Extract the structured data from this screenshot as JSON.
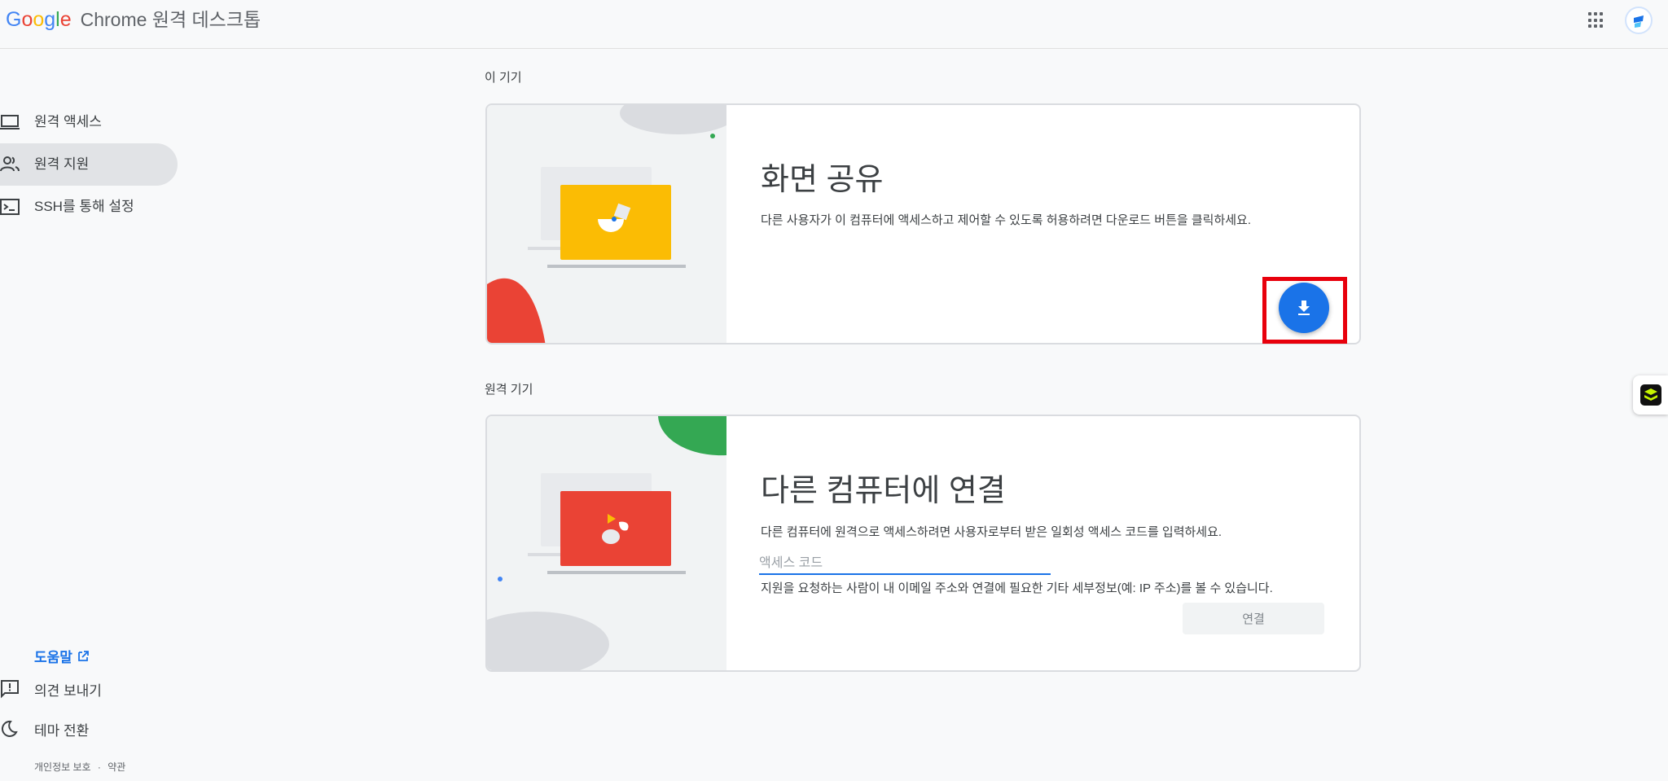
{
  "header": {
    "logo_letters": [
      "G",
      "o",
      "o",
      "g",
      "l",
      "e"
    ],
    "logo_colors": [
      "#4285f4",
      "#ea4335",
      "#fbbc05",
      "#4285f4",
      "#34a853",
      "#ea4335"
    ],
    "product_name": "Chrome 원격 데스크톱",
    "apps_icon": "apps-grid-icon",
    "avatar_icon": "account-avatar"
  },
  "sidebar": {
    "items": [
      {
        "label": "원격 액세스",
        "icon": "laptop-icon",
        "active": false
      },
      {
        "label": "원격 지원",
        "icon": "people-icon",
        "active": true
      },
      {
        "label": "SSH를 통해 설정",
        "icon": "terminal-icon",
        "active": false
      }
    ],
    "help_label": "도움말",
    "help_icon": "external-link-icon",
    "feedback_label": "의견 보내기",
    "feedback_icon": "feedback-icon",
    "theme_label": "테마 전환",
    "theme_icon": "moon-icon",
    "privacy_label": "개인정보 보호",
    "separator": "·",
    "terms_label": "약관"
  },
  "this_device": {
    "section_label": "이 기기",
    "title": "화면 공유",
    "description": "다른 사용자가 이 컴퓨터에 액세스하고 제어할 수 있도록 허용하려면 다운로드 버튼을 클릭하세요.",
    "download_icon": "download-icon",
    "highlight_color": "#e8000c",
    "button_color": "#1a73e8"
  },
  "remote_device": {
    "section_label": "원격 기기",
    "title": "다른 컴퓨터에 연결",
    "description": "다른 컴퓨터에 원격으로 액세스하려면 사용자로부터 받은 일회성 액세스 코드를 입력하세요.",
    "input_placeholder": "액세스 코드",
    "input_value": "",
    "note": "지원을 요청하는 사람이 내 이메일 주소와 연결에 필요한 기타 세부정보(예: IP 주소)를 볼 수 있습니다.",
    "connect_label": "연결"
  },
  "colors": {
    "accent": "#1a73e8",
    "yellow_illus": "#fbbc04",
    "red_illus": "#ea4335",
    "green_illus": "#34a853"
  }
}
